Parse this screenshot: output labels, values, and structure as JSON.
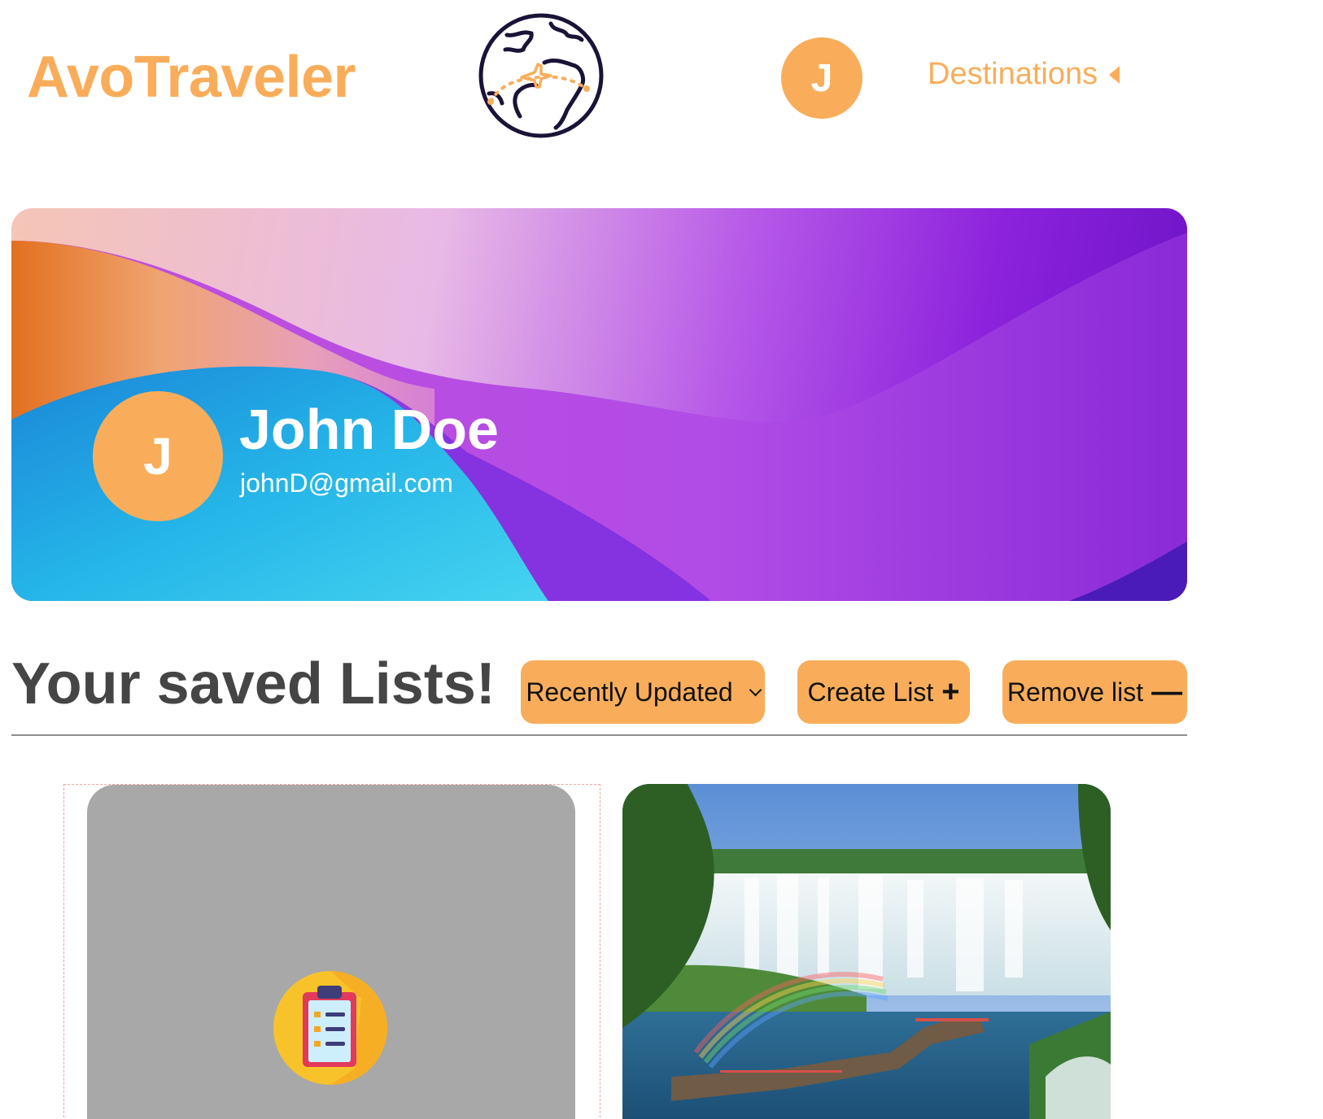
{
  "header": {
    "brand": "AvoTraveler",
    "logo_icon": "globe-plane-icon",
    "avatar_initial": "J",
    "nav_label": "Destinations",
    "nav_icon": "caret-left-icon"
  },
  "profile": {
    "initial": "J",
    "name": "John Doe",
    "email": "johnD@gmail.com"
  },
  "saved_lists": {
    "title": "Your saved Lists!",
    "sort_label": "Recently Updated",
    "create_label": "Create List",
    "remove_label": "Remove list",
    "cards": [
      {
        "kind": "placeholder",
        "icon": "clipboard-list-icon"
      },
      {
        "kind": "photo",
        "image": "waterfall-rainbow-photo"
      }
    ]
  },
  "colors": {
    "accent": "#f9ad5a",
    "heading": "#454545",
    "placeholder_card": "#a8a8a8",
    "logo_stroke": "#1b1337"
  }
}
